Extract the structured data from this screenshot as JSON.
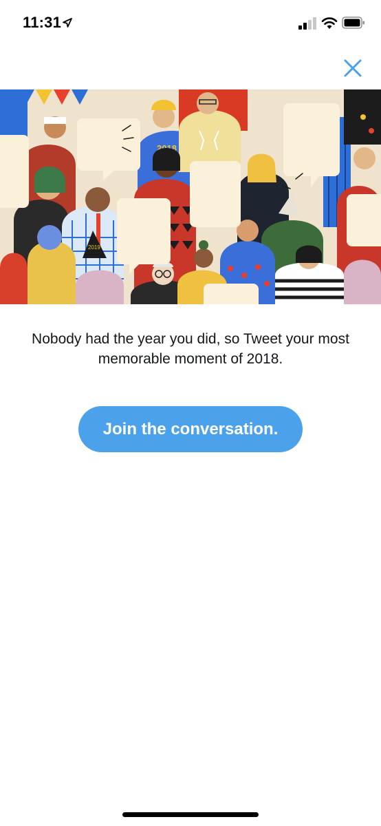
{
  "status_bar": {
    "time": "11:31",
    "icons": [
      "location-arrow-icon",
      "cellular-signal-icon",
      "wifi-icon",
      "battery-icon"
    ]
  },
  "header": {
    "close_icon": "close-icon"
  },
  "banner": {
    "hat_text": "2019",
    "sweater_text": "2018"
  },
  "main": {
    "message": "Nobody had the year you did, so Tweet your most memorable moment of 2018.",
    "cta_label": "Join the conversation."
  },
  "colors": {
    "accent": "#4ba2ea",
    "text": "#14171a",
    "background": "#ffffff"
  }
}
